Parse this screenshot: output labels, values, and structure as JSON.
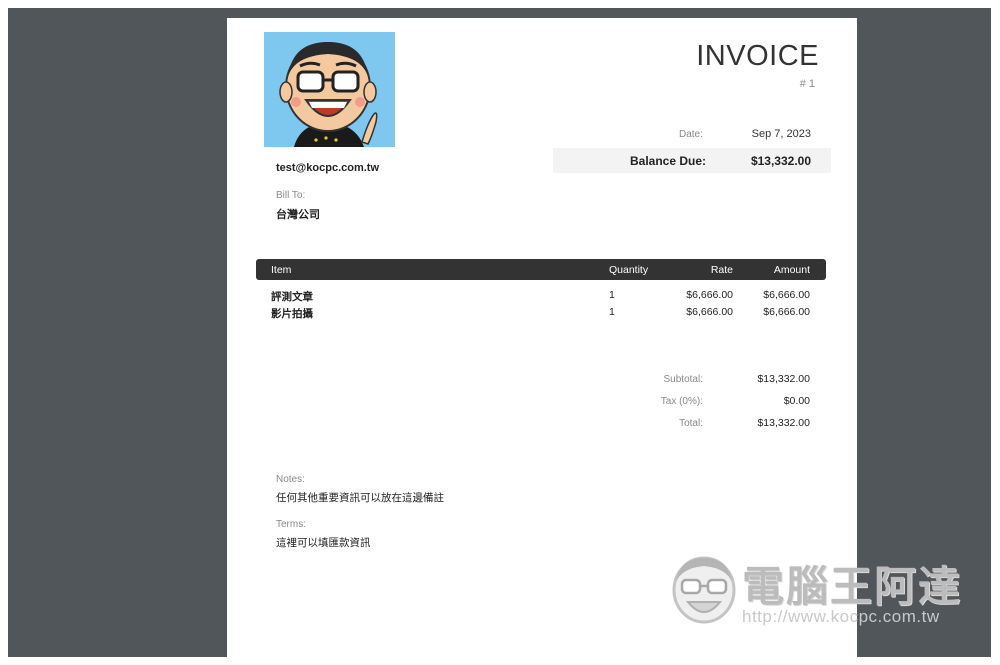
{
  "invoice": {
    "title": "INVOICE",
    "number": "# 1",
    "from_email": "test@kocpc.com.tw",
    "bill_to_label": "Bill To:",
    "bill_to_value": "台灣公司",
    "date_label": "Date:",
    "date_value": "Sep 7, 2023",
    "balance_label": "Balance Due:",
    "balance_value": "$13,332.00"
  },
  "table": {
    "headers": {
      "item": "Item",
      "quantity": "Quantity",
      "rate": "Rate",
      "amount": "Amount"
    },
    "rows": [
      {
        "item": "評測文章",
        "quantity": "1",
        "rate": "$6,666.00",
        "amount": "$6,666.00"
      },
      {
        "item": "影片拍攝",
        "quantity": "1",
        "rate": "$6,666.00",
        "amount": "$6,666.00"
      }
    ]
  },
  "totals": {
    "subtotal_label": "Subtotal:",
    "subtotal_value": "$13,332.00",
    "tax_label": "Tax (0%):",
    "tax_value": "$0.00",
    "total_label": "Total:",
    "total_value": "$13,332.00"
  },
  "notes": {
    "label": "Notes:",
    "value": "任何其他重要資訊可以放在這邊備註"
  },
  "terms": {
    "label": "Terms:",
    "value": "這裡可以填匯款資訊"
  },
  "watermark": {
    "text": "電腦王阿達",
    "url": "http://www.kocpc.com.tw"
  },
  "colors": {
    "frame": "#51565b",
    "table_header": "#333333",
    "avatar_bg": "#7ec8f0"
  },
  "icons": {
    "avatar": "cartoon-avatar-icon",
    "watermark": "watermark-avatar-icon"
  }
}
